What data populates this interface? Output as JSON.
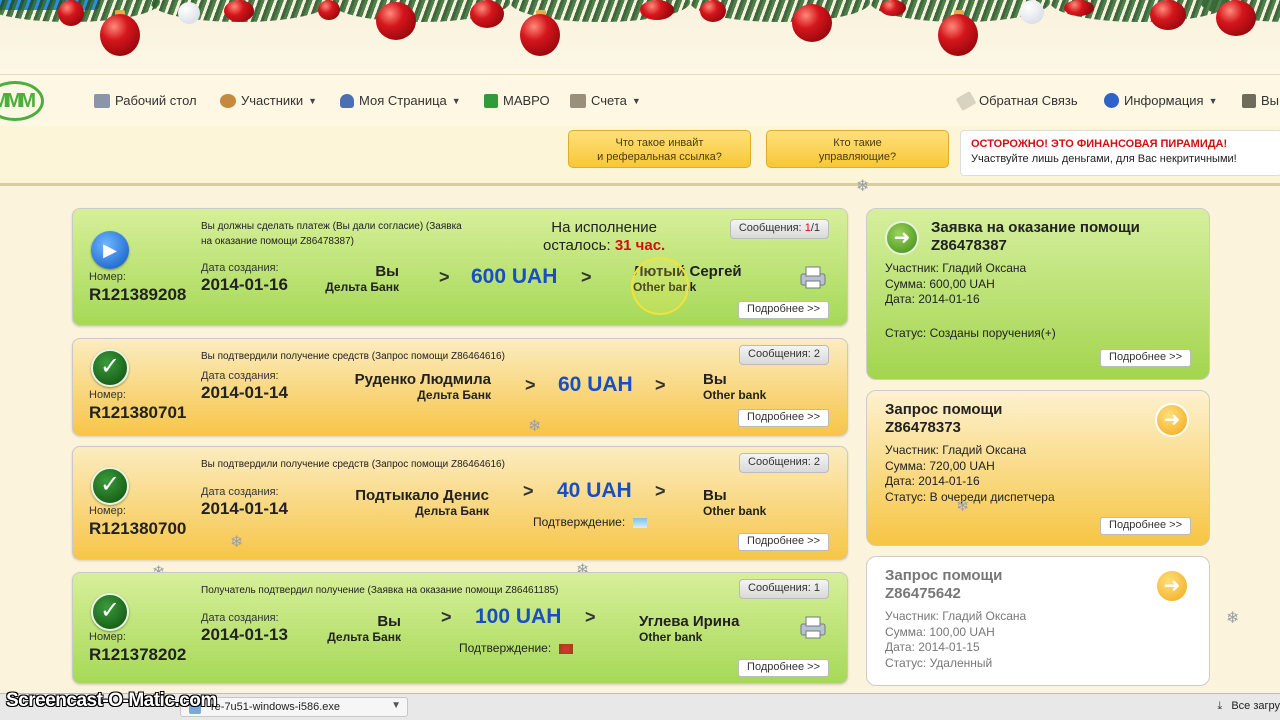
{
  "colors": {
    "accent_blue": "#1a4fc1",
    "warning_red": "#d30f0f",
    "green_card": "#a6d957",
    "orange_card": "#f7c548"
  },
  "nav": {
    "logo_text": "MMM",
    "items": [
      {
        "label": "Рабочий стол",
        "icon": "desktop-icon",
        "dropdown": false
      },
      {
        "label": "Участники",
        "icon": "people-icon",
        "dropdown": true
      },
      {
        "label": "Моя Страница",
        "icon": "user-icon",
        "dropdown": true
      },
      {
        "label": "МАВРО",
        "icon": "mavro-icon",
        "dropdown": false
      },
      {
        "label": "Счета",
        "icon": "accounts-icon",
        "dropdown": true
      }
    ],
    "right": [
      {
        "label": "Обратная Связь",
        "icon": "feedback-icon",
        "dropdown": false
      },
      {
        "label": "Информация",
        "icon": "info-icon",
        "dropdown": true
      },
      {
        "label": "Вы",
        "icon": "exit-icon",
        "dropdown": false
      }
    ]
  },
  "info_buttons": [
    {
      "line1": "Что такое инвайт",
      "line2": "и реферальная ссылка?"
    },
    {
      "line1": "Кто такие",
      "line2": "управляющие?"
    }
  ],
  "warning": {
    "title": "ОСТОРОЖНО! ЭТО ФИНАНСОВАЯ ПИРАМИДА!",
    "text": "Участвуйте лишь деньгами, для Вас некритичными!"
  },
  "labels": {
    "number": "Номер:",
    "created": "Дата создания:",
    "more": "Подробнее >>",
    "confirmation": "Подтверждение:",
    "messages": "Сообщения:",
    "remain_line1": "На исполнение",
    "remain_prefix": "осталось:",
    "remain_value": "31 час."
  },
  "cards": [
    {
      "status": "play",
      "heading1": "Вы должны сделать платеж (Вы дали согласие) (Заявка",
      "heading2": "на оказание помощи Z86478387)",
      "number": "R121389208",
      "date": "2014-01-16",
      "from_name": "Вы",
      "from_bank": "Дельта Банк",
      "amount": "600 UAH",
      "to_name": "Лютый Сергей",
      "to_bank": "Other bank",
      "messages_unread": "1",
      "messages_total": "/1"
    },
    {
      "status": "done",
      "heading1": "Вы подтвердили получение средств (Запрос помощи Z86464616)",
      "number": "R121380701",
      "date": "2014-01-14",
      "from_name": "Руденко Людмила",
      "from_bank": "Дельта Банк",
      "amount": "60 UAH",
      "to_name": "Вы",
      "to_bank": "Other bank",
      "messages": "2"
    },
    {
      "status": "done",
      "heading1": "Вы подтвердили получение средств (Запрос помощи Z86464616)",
      "number": "R121380700",
      "date": "2014-01-14",
      "from_name": "Подтыкало Денис",
      "from_bank": "Дельта Банк",
      "amount": "40 UAH",
      "to_name": "Вы",
      "to_bank": "Other bank",
      "messages": "2"
    },
    {
      "status": "done",
      "heading1": "Получатель подтвердил получение (Заявка на оказание помощи Z86461185)",
      "number": "R121378202",
      "date": "2014-01-13",
      "from_name": "Вы",
      "from_bank": "Дельта Банк",
      "amount": "100 UAH",
      "to_name": "Углева Ирина",
      "to_bank": "Other bank",
      "messages": "1"
    }
  ],
  "panels": [
    {
      "title1": "Заявка на оказание помощи",
      "title2": "Z86478387",
      "participant": "Участник: Гладий Оксана",
      "sum": "Сумма: 600,00 UAH",
      "date": "Дата: 2014-01-16",
      "status": "Статус: Созданы поручения(+)"
    },
    {
      "title1": "Запрос помощи",
      "title2": "Z86478373",
      "participant": "Участник: Гладий Оксана",
      "sum": "Сумма: 720,00 UAH",
      "date": "Дата: 2014-01-16",
      "status": "Статус: В очереди диспетчера"
    },
    {
      "title1": "Запрос помощи",
      "title2": "Z86475642",
      "participant": "Участник: Гладий Оксана",
      "sum": "Сумма: 100,00 UAH",
      "date": "Дата: 2014-01-15",
      "status": "Статус: Удаленный"
    }
  ],
  "download": {
    "file": "re-7u51-windows-i586.exe",
    "all_label": "Все загру"
  },
  "watermark": "Screencast-O-Matic.com"
}
